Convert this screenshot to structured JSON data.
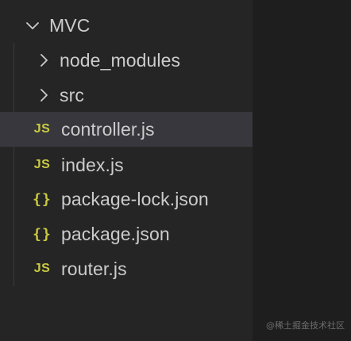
{
  "explorer": {
    "root": {
      "label": "MVC",
      "icon": "chevron-down-icon",
      "expanded": true
    },
    "items": [
      {
        "label": "node_modules",
        "type": "folder",
        "icon": "chevron-right-icon"
      },
      {
        "label": "src",
        "type": "folder",
        "icon": "chevron-right-icon"
      },
      {
        "label": "controller.js",
        "type": "file",
        "icon_text": "JS",
        "icon": "js-file-icon",
        "selected": true
      },
      {
        "label": "index.js",
        "type": "file",
        "icon_text": "JS",
        "icon": "js-file-icon"
      },
      {
        "label": "package-lock.json",
        "type": "file",
        "icon_text": "{}",
        "icon": "json-file-icon"
      },
      {
        "label": "package.json",
        "type": "file",
        "icon_text": "{}",
        "icon": "json-file-icon"
      },
      {
        "label": "router.js",
        "type": "file",
        "icon_text": "JS",
        "icon": "js-file-icon"
      }
    ]
  },
  "colors": {
    "background": "#1e1e1e",
    "sidebar": "#252526",
    "selected_row": "#37373d",
    "text": "#cccccc",
    "file_icon": "#cbcb41"
  },
  "watermark": "@稀土掘金技术社区"
}
